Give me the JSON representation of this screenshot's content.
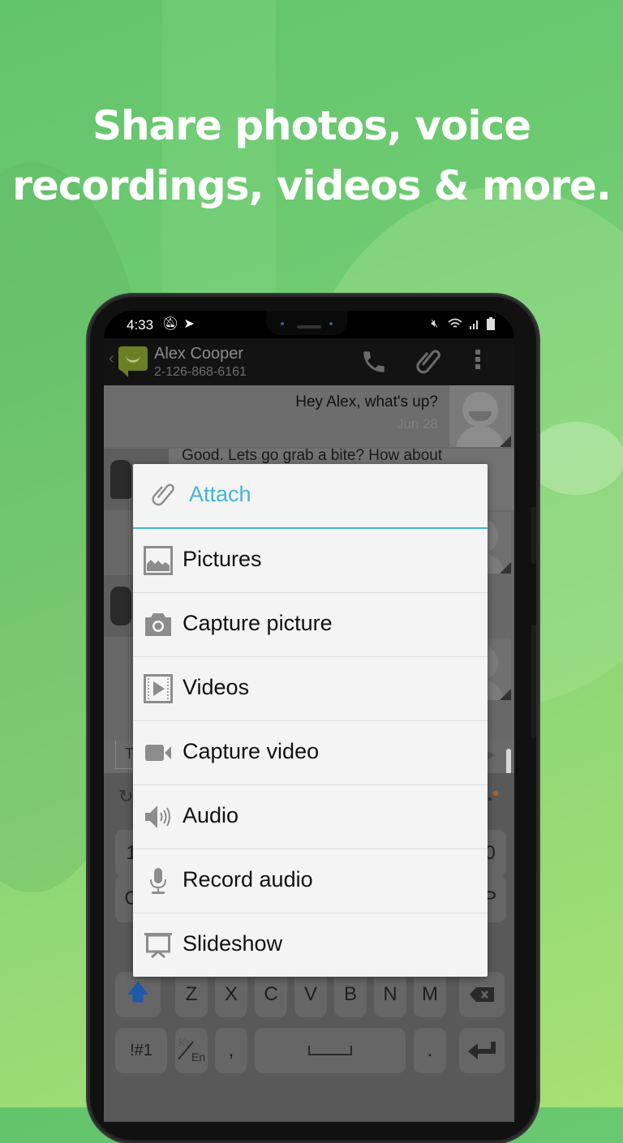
{
  "headline": {
    "line1": "Share photos, voice",
    "line2": "recordings, videos & more."
  },
  "statusbar": {
    "time": "4:33",
    "left_icons": [
      "notifications-muted-icon",
      "send-icon"
    ],
    "right_icons": [
      "mute-icon",
      "wifi-icon",
      "signal-icon",
      "battery-icon"
    ]
  },
  "appbar": {
    "contact_name": "Alex Cooper",
    "contact_phone": "2-126-868-6161",
    "actions": [
      "call-icon",
      "attach-icon",
      "more-options-icon"
    ]
  },
  "conversation": {
    "messages": [
      {
        "direction": "outgoing",
        "text": "Hey Alex, what's up?",
        "date": "Jun 28"
      },
      {
        "direction": "incoming",
        "text": "Good. Lets go grab a bite? How about"
      }
    ],
    "input_hint": "T"
  },
  "keyboard": {
    "partial_row_1_left": "1",
    "partial_row_1_right": "0",
    "partial_row_2_left": "C",
    "partial_row_2_right": "P",
    "row3": [
      "Z",
      "X",
      "C",
      "V",
      "B",
      "N",
      "M"
    ],
    "row4": {
      "symbols": "!#1",
      "lang_top": "Kr",
      "lang_bottom": "En",
      "comma": ",",
      "period": "."
    }
  },
  "dialog": {
    "title": "Attach",
    "accent_color": "#45b4d8",
    "items": [
      {
        "label": "Pictures",
        "icon": "picture-icon"
      },
      {
        "label": "Capture picture",
        "icon": "camera-icon"
      },
      {
        "label": "Videos",
        "icon": "video-file-icon"
      },
      {
        "label": "Capture video",
        "icon": "video-camera-icon"
      },
      {
        "label": "Audio",
        "icon": "speaker-icon"
      },
      {
        "label": "Record audio",
        "icon": "microphone-icon"
      },
      {
        "label": "Slideshow",
        "icon": "slideshow-icon"
      }
    ]
  }
}
